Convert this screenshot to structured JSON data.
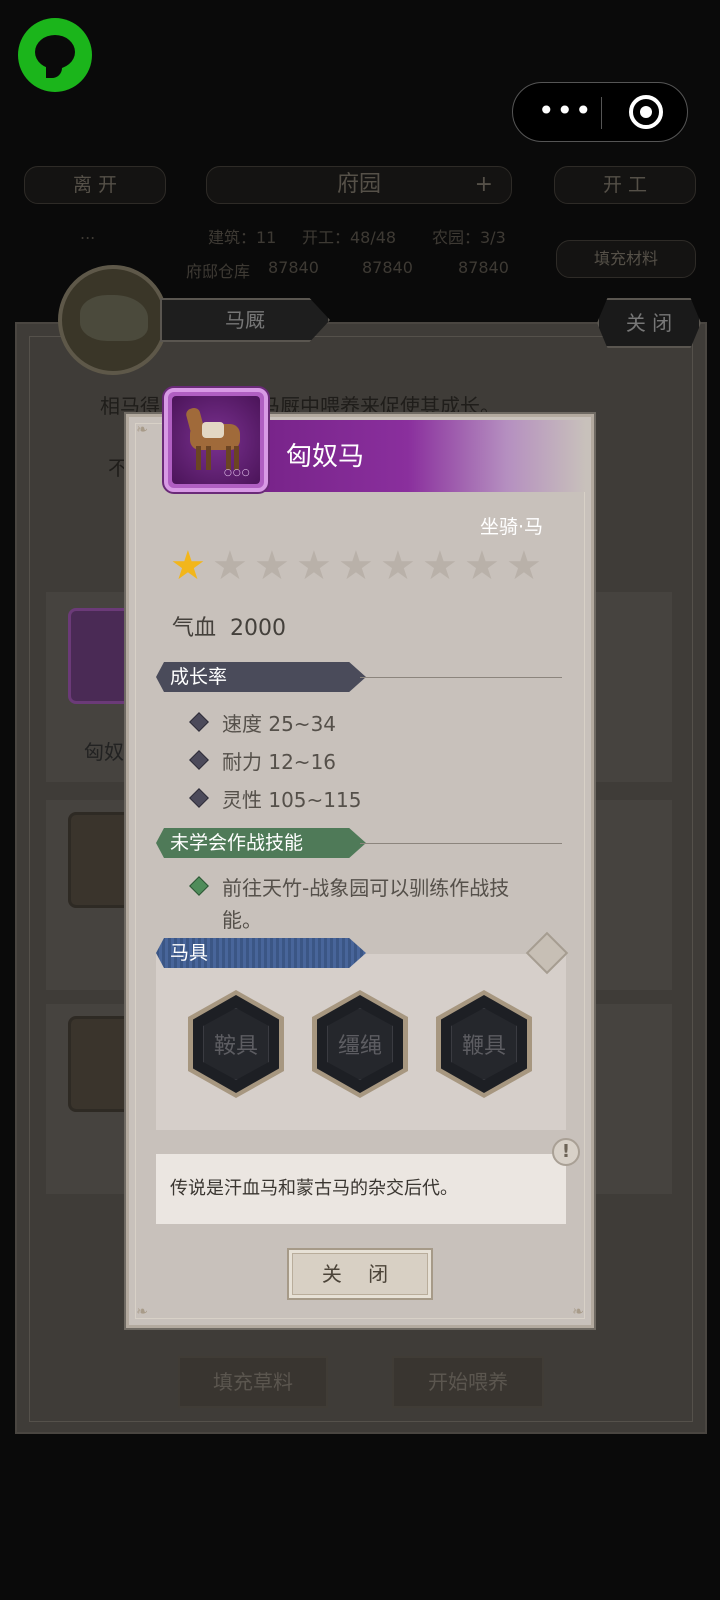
{
  "top_bar": {
    "menu_dots": "•••",
    "background_header": {
      "leave_button": "离 开",
      "garden_title": "府园",
      "plus": "+",
      "start_work_button": "开 工",
      "stats_line1": [
        "...",
        "建筑：11",
        "开工：48/48",
        "农园：3/3"
      ],
      "stats_line2": [
        "府邸仓库",
        "87840",
        "87840",
        "87840"
      ],
      "fill_material_button": "填充材料"
    }
  },
  "stable_panel": {
    "title": "马厩",
    "close_label": "关 闭",
    "intro_text": "相马得以放到府邸马厩中喂养来促使其成长。",
    "intro_text_2": "不",
    "slot1_name": "匈奴",
    "fill_feed_button": "填充草料",
    "start_feed_button": "开始喂养"
  },
  "modal": {
    "horse_name": "匈奴马",
    "portrait_dots": "○○○",
    "type_label": "坐骑·马",
    "star_count": 1,
    "stars_total": 9,
    "hp_label": "气血",
    "hp_value": "2000",
    "growth": {
      "title": "成长率",
      "items": [
        "速度 25~34",
        "耐力 12~16",
        "灵性 105~115"
      ]
    },
    "skills": {
      "title": "未学会作战技能",
      "hint_line1": "前往天竹-战象园可以驯练作战技",
      "hint_line2": "能。"
    },
    "tack": {
      "title": "马具",
      "slots": [
        "鞍具",
        "缰绳",
        "鞭具"
      ]
    },
    "description": "传说是汗血马和蒙古马的杂交后代。",
    "info_icon": "!",
    "close_button": "关 闭"
  },
  "colors": {
    "header_purple": "#8a2f9d",
    "growth_tag": "#4a4b5a",
    "skill_tag": "#4f7a58",
    "tack_tag": "#3f5a85",
    "star_gold": "#f2b61b"
  }
}
